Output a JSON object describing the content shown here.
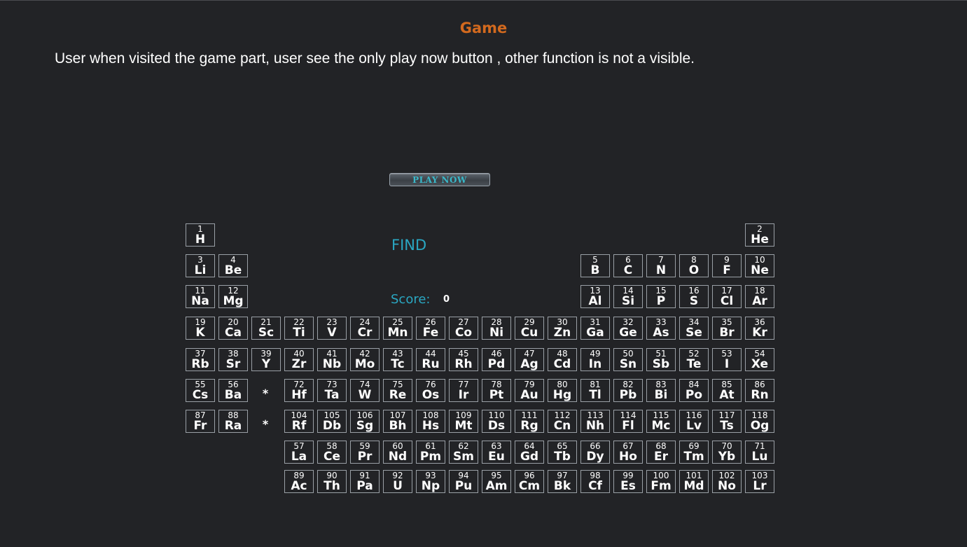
{
  "title": "Game",
  "description": "User when visited the game part, user see the only  play now button , other function is not a visible.",
  "play_button": "PLAY NOW",
  "find_label": "FIND",
  "score_label": "Score:",
  "score_value": "0",
  "lanthanide_marker": "*",
  "actinide_marker": "*",
  "elements": [
    {
      "n": "1",
      "s": "H",
      "row": 0,
      "col": 1
    },
    {
      "n": "2",
      "s": "He",
      "row": 0,
      "col": 18
    },
    {
      "n": "3",
      "s": "Li",
      "row": 1,
      "col": 1
    },
    {
      "n": "4",
      "s": "Be",
      "row": 1,
      "col": 2
    },
    {
      "n": "5",
      "s": "B",
      "row": 1,
      "col": 13
    },
    {
      "n": "6",
      "s": "C",
      "row": 1,
      "col": 14
    },
    {
      "n": "7",
      "s": "N",
      "row": 1,
      "col": 15
    },
    {
      "n": "8",
      "s": "O",
      "row": 1,
      "col": 16
    },
    {
      "n": "9",
      "s": "F",
      "row": 1,
      "col": 17
    },
    {
      "n": "10",
      "s": "Ne",
      "row": 1,
      "col": 18
    },
    {
      "n": "11",
      "s": "Na",
      "row": 2,
      "col": 1
    },
    {
      "n": "12",
      "s": "Mg",
      "row": 2,
      "col": 2
    },
    {
      "n": "13",
      "s": "Al",
      "row": 2,
      "col": 13
    },
    {
      "n": "14",
      "s": "Si",
      "row": 2,
      "col": 14
    },
    {
      "n": "15",
      "s": "P",
      "row": 2,
      "col": 15
    },
    {
      "n": "16",
      "s": "S",
      "row": 2,
      "col": 16
    },
    {
      "n": "17",
      "s": "Cl",
      "row": 2,
      "col": 17
    },
    {
      "n": "18",
      "s": "Ar",
      "row": 2,
      "col": 18
    },
    {
      "n": "19",
      "s": "K",
      "row": 3,
      "col": 1
    },
    {
      "n": "20",
      "s": "Ca",
      "row": 3,
      "col": 2
    },
    {
      "n": "21",
      "s": "Sc",
      "row": 3,
      "col": 3
    },
    {
      "n": "22",
      "s": "Ti",
      "row": 3,
      "col": 4
    },
    {
      "n": "23",
      "s": "V",
      "row": 3,
      "col": 5
    },
    {
      "n": "24",
      "s": "Cr",
      "row": 3,
      "col": 6
    },
    {
      "n": "25",
      "s": "Mn",
      "row": 3,
      "col": 7
    },
    {
      "n": "26",
      "s": "Fe",
      "row": 3,
      "col": 8
    },
    {
      "n": "27",
      "s": "Co",
      "row": 3,
      "col": 9
    },
    {
      "n": "28",
      "s": "Ni",
      "row": 3,
      "col": 10
    },
    {
      "n": "29",
      "s": "Cu",
      "row": 3,
      "col": 11
    },
    {
      "n": "30",
      "s": "Zn",
      "row": 3,
      "col": 12
    },
    {
      "n": "31",
      "s": "Ga",
      "row": 3,
      "col": 13
    },
    {
      "n": "32",
      "s": "Ge",
      "row": 3,
      "col": 14
    },
    {
      "n": "33",
      "s": "As",
      "row": 3,
      "col": 15
    },
    {
      "n": "34",
      "s": "Se",
      "row": 3,
      "col": 16
    },
    {
      "n": "35",
      "s": "Br",
      "row": 3,
      "col": 17
    },
    {
      "n": "36",
      "s": "Kr",
      "row": 3,
      "col": 18
    },
    {
      "n": "37",
      "s": "Rb",
      "row": 4,
      "col": 1
    },
    {
      "n": "38",
      "s": "Sr",
      "row": 4,
      "col": 2
    },
    {
      "n": "39",
      "s": "Y",
      "row": 4,
      "col": 3
    },
    {
      "n": "40",
      "s": "Zr",
      "row": 4,
      "col": 4
    },
    {
      "n": "41",
      "s": "Nb",
      "row": 4,
      "col": 5
    },
    {
      "n": "42",
      "s": "Mo",
      "row": 4,
      "col": 6
    },
    {
      "n": "43",
      "s": "Tc",
      "row": 4,
      "col": 7
    },
    {
      "n": "44",
      "s": "Ru",
      "row": 4,
      "col": 8
    },
    {
      "n": "45",
      "s": "Rh",
      "row": 4,
      "col": 9
    },
    {
      "n": "46",
      "s": "Pd",
      "row": 4,
      "col": 10
    },
    {
      "n": "47",
      "s": "Ag",
      "row": 4,
      "col": 11
    },
    {
      "n": "48",
      "s": "Cd",
      "row": 4,
      "col": 12
    },
    {
      "n": "49",
      "s": "In",
      "row": 4,
      "col": 13
    },
    {
      "n": "50",
      "s": "Sn",
      "row": 4,
      "col": 14
    },
    {
      "n": "51",
      "s": "Sb",
      "row": 4,
      "col": 15
    },
    {
      "n": "52",
      "s": "Te",
      "row": 4,
      "col": 16
    },
    {
      "n": "53",
      "s": "I",
      "row": 4,
      "col": 17
    },
    {
      "n": "54",
      "s": "Xe",
      "row": 4,
      "col": 18
    },
    {
      "n": "55",
      "s": "Cs",
      "row": 5,
      "col": 1
    },
    {
      "n": "56",
      "s": "Ba",
      "row": 5,
      "col": 2
    },
    {
      "n": "72",
      "s": "Hf",
      "row": 5,
      "col": 4
    },
    {
      "n": "73",
      "s": "Ta",
      "row": 5,
      "col": 5
    },
    {
      "n": "74",
      "s": "W",
      "row": 5,
      "col": 6
    },
    {
      "n": "75",
      "s": "Re",
      "row": 5,
      "col": 7
    },
    {
      "n": "76",
      "s": "Os",
      "row": 5,
      "col": 8
    },
    {
      "n": "77",
      "s": "Ir",
      "row": 5,
      "col": 9
    },
    {
      "n": "78",
      "s": "Pt",
      "row": 5,
      "col": 10
    },
    {
      "n": "79",
      "s": "Au",
      "row": 5,
      "col": 11
    },
    {
      "n": "80",
      "s": "Hg",
      "row": 5,
      "col": 12
    },
    {
      "n": "81",
      "s": "Tl",
      "row": 5,
      "col": 13
    },
    {
      "n": "82",
      "s": "Pb",
      "row": 5,
      "col": 14
    },
    {
      "n": "83",
      "s": "Bi",
      "row": 5,
      "col": 15
    },
    {
      "n": "84",
      "s": "Po",
      "row": 5,
      "col": 16
    },
    {
      "n": "85",
      "s": "At",
      "row": 5,
      "col": 17
    },
    {
      "n": "86",
      "s": "Rn",
      "row": 5,
      "col": 18
    },
    {
      "n": "87",
      "s": "Fr",
      "row": 6,
      "col": 1
    },
    {
      "n": "88",
      "s": "Ra",
      "row": 6,
      "col": 2
    },
    {
      "n": "104",
      "s": "Rf",
      "row": 6,
      "col": 4
    },
    {
      "n": "105",
      "s": "Db",
      "row": 6,
      "col": 5
    },
    {
      "n": "106",
      "s": "Sg",
      "row": 6,
      "col": 6
    },
    {
      "n": "107",
      "s": "Bh",
      "row": 6,
      "col": 7
    },
    {
      "n": "108",
      "s": "Hs",
      "row": 6,
      "col": 8
    },
    {
      "n": "109",
      "s": "Mt",
      "row": 6,
      "col": 9
    },
    {
      "n": "110",
      "s": "Ds",
      "row": 6,
      "col": 10
    },
    {
      "n": "111",
      "s": "Rg",
      "row": 6,
      "col": 11
    },
    {
      "n": "112",
      "s": "Cn",
      "row": 6,
      "col": 12
    },
    {
      "n": "113",
      "s": "Nh",
      "row": 6,
      "col": 13
    },
    {
      "n": "114",
      "s": "Fl",
      "row": 6,
      "col": 14
    },
    {
      "n": "115",
      "s": "Mc",
      "row": 6,
      "col": 15
    },
    {
      "n": "116",
      "s": "Lv",
      "row": 6,
      "col": 16
    },
    {
      "n": "117",
      "s": "Ts",
      "row": 6,
      "col": 17
    },
    {
      "n": "118",
      "s": "Og",
      "row": 6,
      "col": 18
    },
    {
      "n": "57",
      "s": "La",
      "row": 7,
      "col": 4
    },
    {
      "n": "58",
      "s": "Ce",
      "row": 7,
      "col": 5
    },
    {
      "n": "59",
      "s": "Pr",
      "row": 7,
      "col": 6
    },
    {
      "n": "60",
      "s": "Nd",
      "row": 7,
      "col": 7
    },
    {
      "n": "61",
      "s": "Pm",
      "row": 7,
      "col": 8
    },
    {
      "n": "62",
      "s": "Sm",
      "row": 7,
      "col": 9
    },
    {
      "n": "63",
      "s": "Eu",
      "row": 7,
      "col": 10
    },
    {
      "n": "64",
      "s": "Gd",
      "row": 7,
      "col": 11
    },
    {
      "n": "65",
      "s": "Tb",
      "row": 7,
      "col": 12
    },
    {
      "n": "66",
      "s": "Dy",
      "row": 7,
      "col": 13
    },
    {
      "n": "67",
      "s": "Ho",
      "row": 7,
      "col": 14
    },
    {
      "n": "68",
      "s": "Er",
      "row": 7,
      "col": 15
    },
    {
      "n": "69",
      "s": "Tm",
      "row": 7,
      "col": 16
    },
    {
      "n": "70",
      "s": "Yb",
      "row": 7,
      "col": 17
    },
    {
      "n": "71",
      "s": "Lu",
      "row": 7,
      "col": 18
    },
    {
      "n": "89",
      "s": "Ac",
      "row": 8,
      "col": 4
    },
    {
      "n": "90",
      "s": "Th",
      "row": 8,
      "col": 5
    },
    {
      "n": "91",
      "s": "Pa",
      "row": 8,
      "col": 6
    },
    {
      "n": "92",
      "s": "U",
      "row": 8,
      "col": 7
    },
    {
      "n": "93",
      "s": "Np",
      "row": 8,
      "col": 8
    },
    {
      "n": "94",
      "s": "Pu",
      "row": 8,
      "col": 9
    },
    {
      "n": "95",
      "s": "Am",
      "row": 8,
      "col": 10
    },
    {
      "n": "96",
      "s": "Cm",
      "row": 8,
      "col": 11
    },
    {
      "n": "97",
      "s": "Bk",
      "row": 8,
      "col": 12
    },
    {
      "n": "98",
      "s": "Cf",
      "row": 8,
      "col": 13
    },
    {
      "n": "99",
      "s": "Es",
      "row": 8,
      "col": 14
    },
    {
      "n": "100",
      "s": "Fm",
      "row": 8,
      "col": 15
    },
    {
      "n": "101",
      "s": "Md",
      "row": 8,
      "col": 16
    },
    {
      "n": "102",
      "s": "No",
      "row": 8,
      "col": 17
    },
    {
      "n": "103",
      "s": "Lr",
      "row": 8,
      "col": 18
    }
  ]
}
